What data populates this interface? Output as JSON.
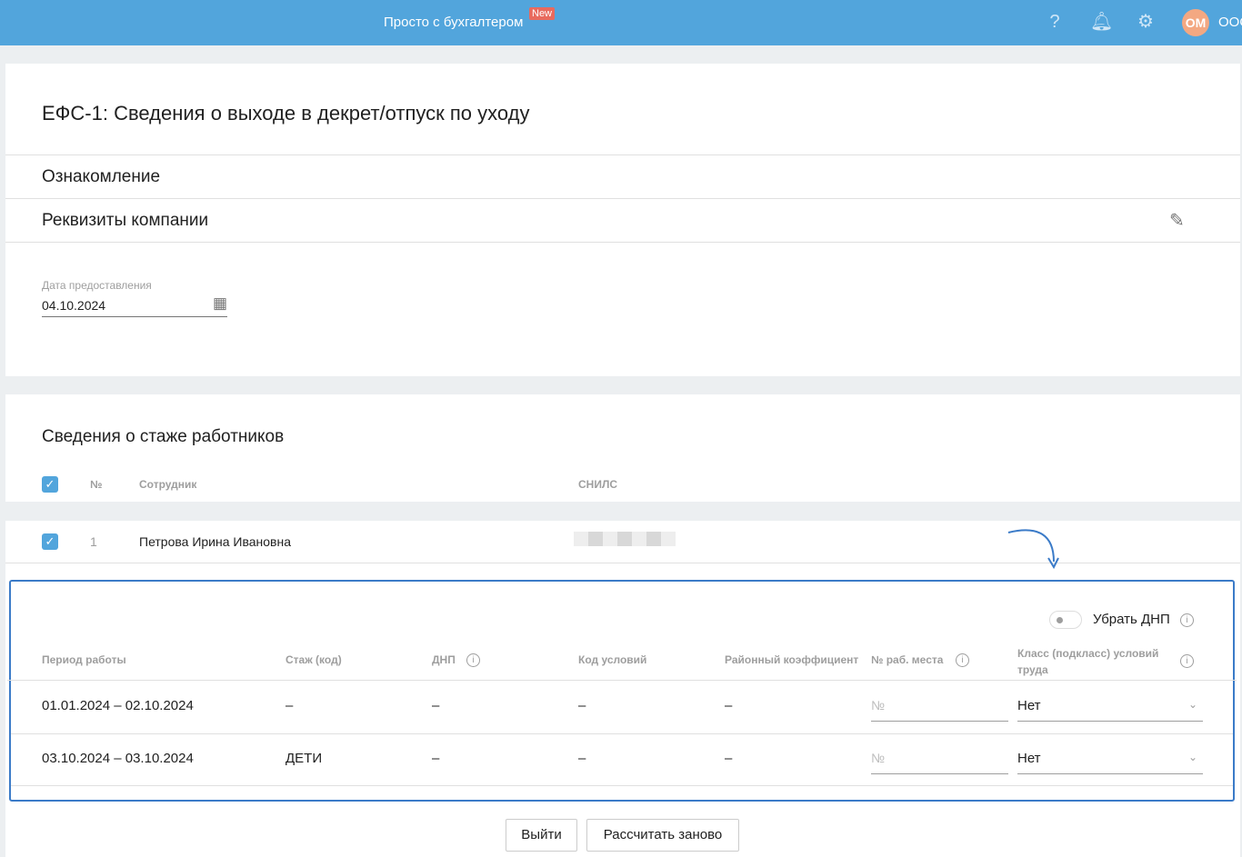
{
  "header": {
    "brand": "Просто с бухгалтером",
    "new_badge": "New",
    "avatar": "ОМ",
    "org": "ООО"
  },
  "page_title": "ЕФС-1: Сведения о выходе в декрет/отпуск по уходу",
  "sections": {
    "intro": "Ознакомление",
    "company": "Реквизиты компании"
  },
  "date_field": {
    "label": "Дата предоставления",
    "value": "04.10.2024"
  },
  "staff": {
    "title": "Сведения о стаже работников",
    "col_no": "№",
    "col_employee": "Сотрудник",
    "col_snils": "СНИЛС",
    "row": {
      "no": "1",
      "name": "Петрова Ирина Ивановна"
    }
  },
  "details": {
    "toggle_label": "Убрать ДНП",
    "columns": [
      "Период работы",
      "Стаж (код)",
      "ДНП",
      "Код условий",
      "Районный коэффициент",
      "№ раб. места",
      "Класс (подкласс) условий труда"
    ],
    "rows": [
      {
        "period": "01.01.2024 – 02.10.2024",
        "stazh": "–",
        "dnp": "–",
        "code": "–",
        "coef": "–",
        "place_placeholder": "№",
        "class": "Нет"
      },
      {
        "period": "03.10.2024 – 03.10.2024",
        "stazh": "ДЕТИ",
        "dnp": "–",
        "code": "–",
        "coef": "–",
        "place_placeholder": "№",
        "class": "Нет"
      }
    ]
  },
  "buttons": {
    "exit": "Выйти",
    "recalc": "Рассчитать заново"
  },
  "colors": {
    "header": "#52a5dc",
    "accent": "#3b7bc8"
  }
}
